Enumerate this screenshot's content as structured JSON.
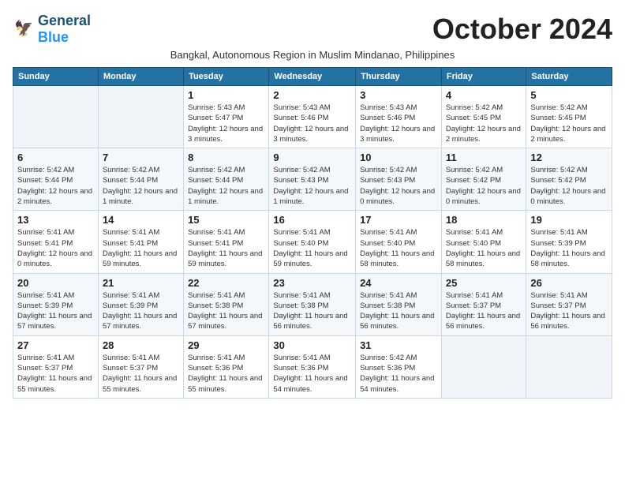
{
  "logo": {
    "general": "General",
    "blue": "Blue"
  },
  "title": "October 2024",
  "subtitle": "Bangkal, Autonomous Region in Muslim Mindanao, Philippines",
  "days_header": [
    "Sunday",
    "Monday",
    "Tuesday",
    "Wednesday",
    "Thursday",
    "Friday",
    "Saturday"
  ],
  "weeks": [
    [
      {
        "day": "",
        "info": ""
      },
      {
        "day": "",
        "info": ""
      },
      {
        "day": "1",
        "info": "Sunrise: 5:43 AM\nSunset: 5:47 PM\nDaylight: 12 hours and 3 minutes."
      },
      {
        "day": "2",
        "info": "Sunrise: 5:43 AM\nSunset: 5:46 PM\nDaylight: 12 hours and 3 minutes."
      },
      {
        "day": "3",
        "info": "Sunrise: 5:43 AM\nSunset: 5:46 PM\nDaylight: 12 hours and 3 minutes."
      },
      {
        "day": "4",
        "info": "Sunrise: 5:42 AM\nSunset: 5:45 PM\nDaylight: 12 hours and 2 minutes."
      },
      {
        "day": "5",
        "info": "Sunrise: 5:42 AM\nSunset: 5:45 PM\nDaylight: 12 hours and 2 minutes."
      }
    ],
    [
      {
        "day": "6",
        "info": "Sunrise: 5:42 AM\nSunset: 5:44 PM\nDaylight: 12 hours and 2 minutes."
      },
      {
        "day": "7",
        "info": "Sunrise: 5:42 AM\nSunset: 5:44 PM\nDaylight: 12 hours and 1 minute."
      },
      {
        "day": "8",
        "info": "Sunrise: 5:42 AM\nSunset: 5:44 PM\nDaylight: 12 hours and 1 minute."
      },
      {
        "day": "9",
        "info": "Sunrise: 5:42 AM\nSunset: 5:43 PM\nDaylight: 12 hours and 1 minute."
      },
      {
        "day": "10",
        "info": "Sunrise: 5:42 AM\nSunset: 5:43 PM\nDaylight: 12 hours and 0 minutes."
      },
      {
        "day": "11",
        "info": "Sunrise: 5:42 AM\nSunset: 5:42 PM\nDaylight: 12 hours and 0 minutes."
      },
      {
        "day": "12",
        "info": "Sunrise: 5:42 AM\nSunset: 5:42 PM\nDaylight: 12 hours and 0 minutes."
      }
    ],
    [
      {
        "day": "13",
        "info": "Sunrise: 5:41 AM\nSunset: 5:41 PM\nDaylight: 12 hours and 0 minutes."
      },
      {
        "day": "14",
        "info": "Sunrise: 5:41 AM\nSunset: 5:41 PM\nDaylight: 11 hours and 59 minutes."
      },
      {
        "day": "15",
        "info": "Sunrise: 5:41 AM\nSunset: 5:41 PM\nDaylight: 11 hours and 59 minutes."
      },
      {
        "day": "16",
        "info": "Sunrise: 5:41 AM\nSunset: 5:40 PM\nDaylight: 11 hours and 59 minutes."
      },
      {
        "day": "17",
        "info": "Sunrise: 5:41 AM\nSunset: 5:40 PM\nDaylight: 11 hours and 58 minutes."
      },
      {
        "day": "18",
        "info": "Sunrise: 5:41 AM\nSunset: 5:40 PM\nDaylight: 11 hours and 58 minutes."
      },
      {
        "day": "19",
        "info": "Sunrise: 5:41 AM\nSunset: 5:39 PM\nDaylight: 11 hours and 58 minutes."
      }
    ],
    [
      {
        "day": "20",
        "info": "Sunrise: 5:41 AM\nSunset: 5:39 PM\nDaylight: 11 hours and 57 minutes."
      },
      {
        "day": "21",
        "info": "Sunrise: 5:41 AM\nSunset: 5:39 PM\nDaylight: 11 hours and 57 minutes."
      },
      {
        "day": "22",
        "info": "Sunrise: 5:41 AM\nSunset: 5:38 PM\nDaylight: 11 hours and 57 minutes."
      },
      {
        "day": "23",
        "info": "Sunrise: 5:41 AM\nSunset: 5:38 PM\nDaylight: 11 hours and 56 minutes."
      },
      {
        "day": "24",
        "info": "Sunrise: 5:41 AM\nSunset: 5:38 PM\nDaylight: 11 hours and 56 minutes."
      },
      {
        "day": "25",
        "info": "Sunrise: 5:41 AM\nSunset: 5:37 PM\nDaylight: 11 hours and 56 minutes."
      },
      {
        "day": "26",
        "info": "Sunrise: 5:41 AM\nSunset: 5:37 PM\nDaylight: 11 hours and 56 minutes."
      }
    ],
    [
      {
        "day": "27",
        "info": "Sunrise: 5:41 AM\nSunset: 5:37 PM\nDaylight: 11 hours and 55 minutes."
      },
      {
        "day": "28",
        "info": "Sunrise: 5:41 AM\nSunset: 5:37 PM\nDaylight: 11 hours and 55 minutes."
      },
      {
        "day": "29",
        "info": "Sunrise: 5:41 AM\nSunset: 5:36 PM\nDaylight: 11 hours and 55 minutes."
      },
      {
        "day": "30",
        "info": "Sunrise: 5:41 AM\nSunset: 5:36 PM\nDaylight: 11 hours and 54 minutes."
      },
      {
        "day": "31",
        "info": "Sunrise: 5:42 AM\nSunset: 5:36 PM\nDaylight: 11 hours and 54 minutes."
      },
      {
        "day": "",
        "info": ""
      },
      {
        "day": "",
        "info": ""
      }
    ]
  ]
}
